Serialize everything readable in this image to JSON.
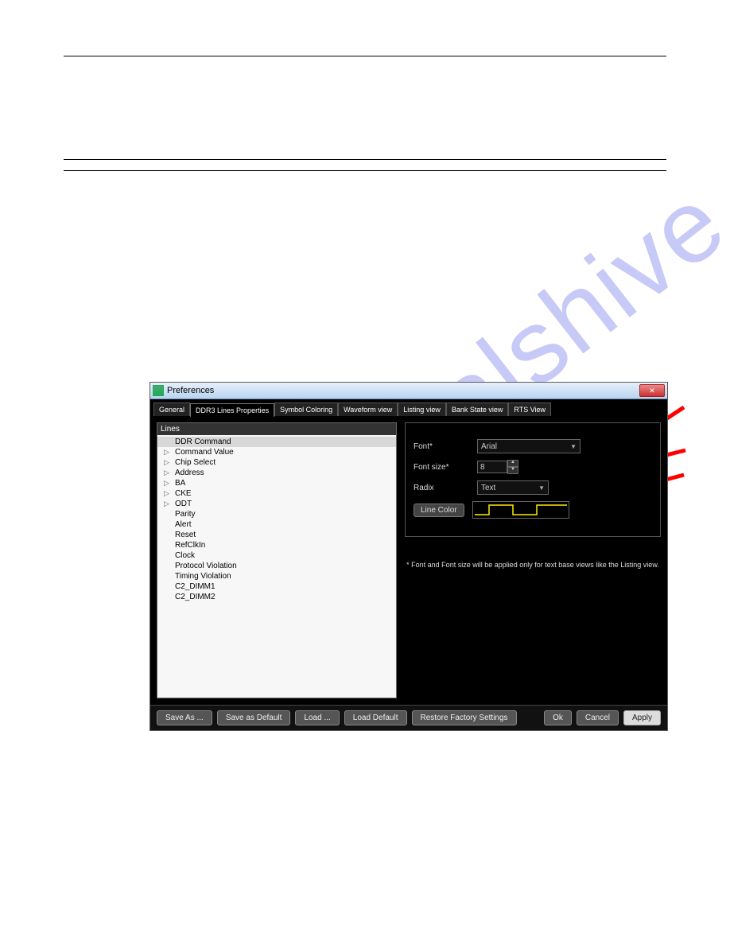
{
  "watermark": "manualshive.com",
  "dialog": {
    "title": "Preferences",
    "tabs": [
      "General",
      "DDR3 Lines Properties",
      "Symbol Coloring",
      "Waveform view",
      "Listing view",
      "Bank State view",
      "RTS View"
    ],
    "active_tab": 1,
    "lines_header": "Lines",
    "lines": [
      {
        "label": "DDR Command",
        "selected": true,
        "exp": false
      },
      {
        "label": "Command Value",
        "exp": true
      },
      {
        "label": "Chip Select",
        "exp": true
      },
      {
        "label": "Address",
        "exp": true
      },
      {
        "label": "BA",
        "exp": true
      },
      {
        "label": "CKE",
        "exp": true
      },
      {
        "label": "ODT",
        "exp": true
      },
      {
        "label": "Parity",
        "exp": false
      },
      {
        "label": "Alert",
        "exp": false
      },
      {
        "label": "Reset",
        "exp": false
      },
      {
        "label": "RefClkIn",
        "exp": false
      },
      {
        "label": "Clock",
        "exp": false
      },
      {
        "label": "Protocol Violation",
        "exp": false
      },
      {
        "label": "Timing Violation",
        "exp": false
      },
      {
        "label": "C2_DIMM1",
        "exp": false
      },
      {
        "label": "C2_DIMM2",
        "exp": false
      }
    ],
    "form": {
      "font_label": "Font*",
      "font_value": "Arial",
      "fontsize_label": "Font size*",
      "fontsize_value": "8",
      "radix_label": "Radix",
      "radix_value": "Text",
      "linecolor_btn": "Line Color"
    },
    "note": "*   Font and Font size will be applied only for text base views like the Listing view.",
    "footer": {
      "saveas": "Save As ...",
      "savedef": "Save as Default",
      "load": "Load ...",
      "loaddef": "Load Default",
      "restore": "Restore Factory Settings",
      "ok": "Ok",
      "cancel": "Cancel",
      "apply": "Apply"
    }
  }
}
